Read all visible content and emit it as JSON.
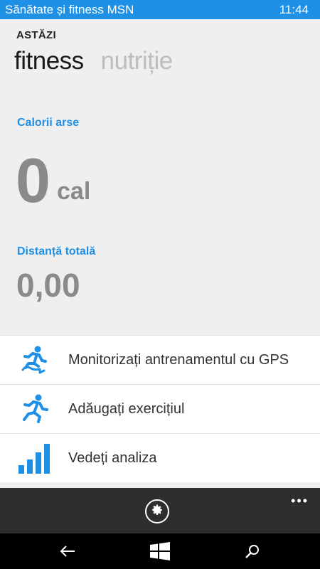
{
  "status_bar": {
    "app_title": "Sănătate și fitness MSN",
    "time": "11:44"
  },
  "header": {
    "section": "ASTĂZI",
    "tabs": [
      {
        "label": "fitness",
        "active": true
      },
      {
        "label": "nutriție",
        "active": false
      }
    ]
  },
  "stats": {
    "calories": {
      "label": "Calorii arse",
      "value": "0",
      "unit": "cal"
    },
    "distance": {
      "label": "Distanță totală",
      "value": "0,00"
    }
  },
  "actions": [
    {
      "label": "Monitorizați antrenamentul cu GPS",
      "icon": "gps-runner-icon"
    },
    {
      "label": "Adăugați exercițiul",
      "icon": "runner-icon"
    },
    {
      "label": "Vedeți analiza",
      "icon": "bar-chart-icon"
    }
  ],
  "app_bar": {
    "settings_icon": "gear-icon",
    "more_label": "•••"
  },
  "colors": {
    "accent": "#1e90e6",
    "background": "#efefef",
    "stat_gray": "#8a8a8a",
    "app_bar": "#2e2e2e"
  }
}
